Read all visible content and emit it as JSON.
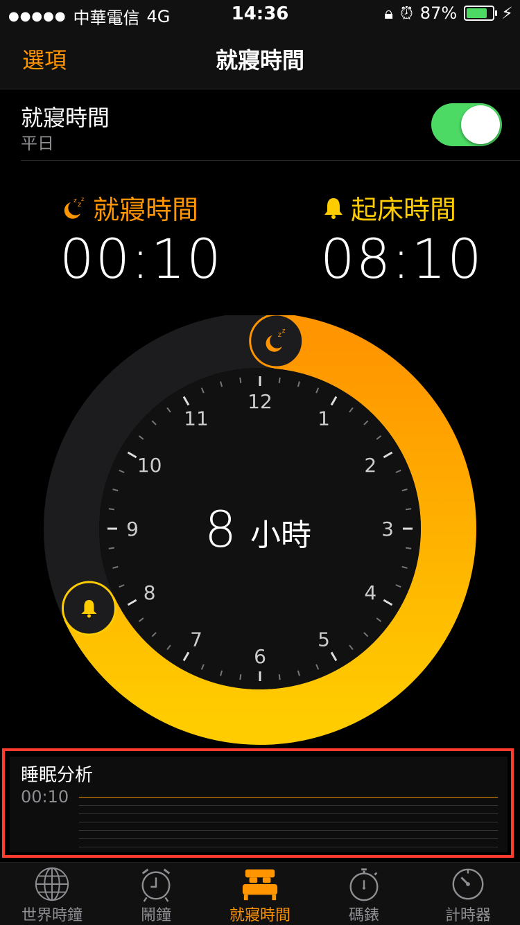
{
  "status_bar": {
    "carrier": "中華電信",
    "network": "4G",
    "time": "14:36",
    "battery_percent": "87%",
    "battery_level": 0.87
  },
  "nav": {
    "options_label": "選項",
    "title": "就寢時間"
  },
  "bedtime_row": {
    "label": "就寢時間",
    "subtitle": "平日",
    "toggle_on": true
  },
  "bedtime": {
    "label": "就寢時間",
    "time": "00:10"
  },
  "wake": {
    "label": "起床時間",
    "time": "08:10"
  },
  "dial": {
    "duration_number": "8",
    "duration_unit": "小時",
    "hour_labels": [
      "12",
      "1",
      "2",
      "3",
      "4",
      "5",
      "6",
      "7",
      "8",
      "9",
      "10",
      "11"
    ],
    "bedtime_hour": 0.1667,
    "wake_hour": 8.1667
  },
  "analysis": {
    "title": "睡眠分析",
    "time": "00:10"
  },
  "tabs": [
    {
      "label": "世界時鐘",
      "icon": "globe-icon",
      "active": false
    },
    {
      "label": "鬧鐘",
      "icon": "alarm-clock-icon",
      "active": false
    },
    {
      "label": "就寢時間",
      "icon": "bed-icon",
      "active": true
    },
    {
      "label": "碼錶",
      "icon": "stopwatch-icon",
      "active": false
    },
    {
      "label": "計時器",
      "icon": "timer-icon",
      "active": false
    }
  ],
  "colors": {
    "accent": "#ff9500",
    "wake": "#ffcc00",
    "toggle": "#4cd964"
  }
}
